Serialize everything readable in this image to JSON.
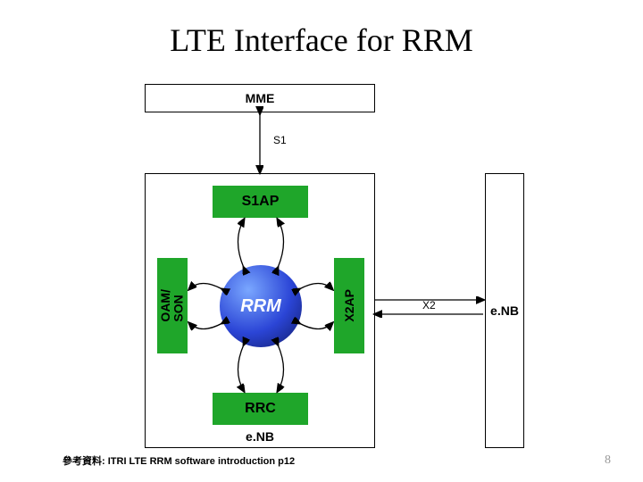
{
  "title": "LTE Interface for RRM",
  "footnote": "參考資料: ITRI LTE RRM software introduction p12",
  "slide_number": "8",
  "nodes": {
    "mme": "MME",
    "s1ap": "S1AP",
    "rrm": "RRM",
    "x2ap": "X2AP",
    "oam_son_line1": "OAM/",
    "oam_son_line2": "SON",
    "rrc": "RRC",
    "enb_bottom": "e.NB",
    "enb_right": "e.NB"
  },
  "edges": {
    "s1": "S1",
    "x2": "X2"
  }
}
